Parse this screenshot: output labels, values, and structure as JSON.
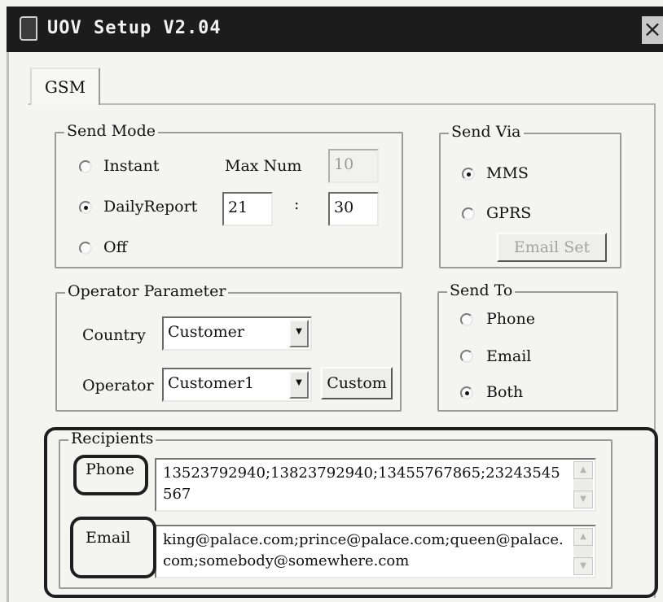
{
  "window": {
    "title": "UOV Setup V2.04",
    "close_glyph": "×"
  },
  "tab": {
    "label": "GSM"
  },
  "send_mode": {
    "legend": "Send Mode",
    "instant": "Instant",
    "daily_report": "DailyReport",
    "off": "Off",
    "selected": "DailyReport",
    "max_num_label": "Max Num",
    "max_num_value": "10",
    "hour": "21",
    "separator": ":",
    "minute": "30"
  },
  "send_via": {
    "legend": "Send Via",
    "mms": "MMS",
    "gprs": "GPRS",
    "selected": "MMS",
    "email_set_label": "Email Set"
  },
  "operator_parameter": {
    "legend": "Operator Parameter",
    "country_label": "Country",
    "country_value": "Customer",
    "operator_label": "Operator",
    "operator_value": "Customer1",
    "custom_button": "Custom"
  },
  "send_to": {
    "legend": "Send To",
    "phone": "Phone",
    "email": "Email",
    "both": "Both",
    "selected": "Both"
  },
  "recipients": {
    "legend": "Recipients",
    "phone_label": "Phone",
    "phone_value": "13523792940;13823792940;13455767865;23243545567",
    "email_label": "Email",
    "email_value": "king@palace.com;prince@palace.com;queen@palace.com;somebody@somewhere.com"
  },
  "icons": [
    "app-icon",
    "close-icon",
    "chevron-down-icon",
    "scroll-up-icon",
    "scroll-down-icon"
  ]
}
